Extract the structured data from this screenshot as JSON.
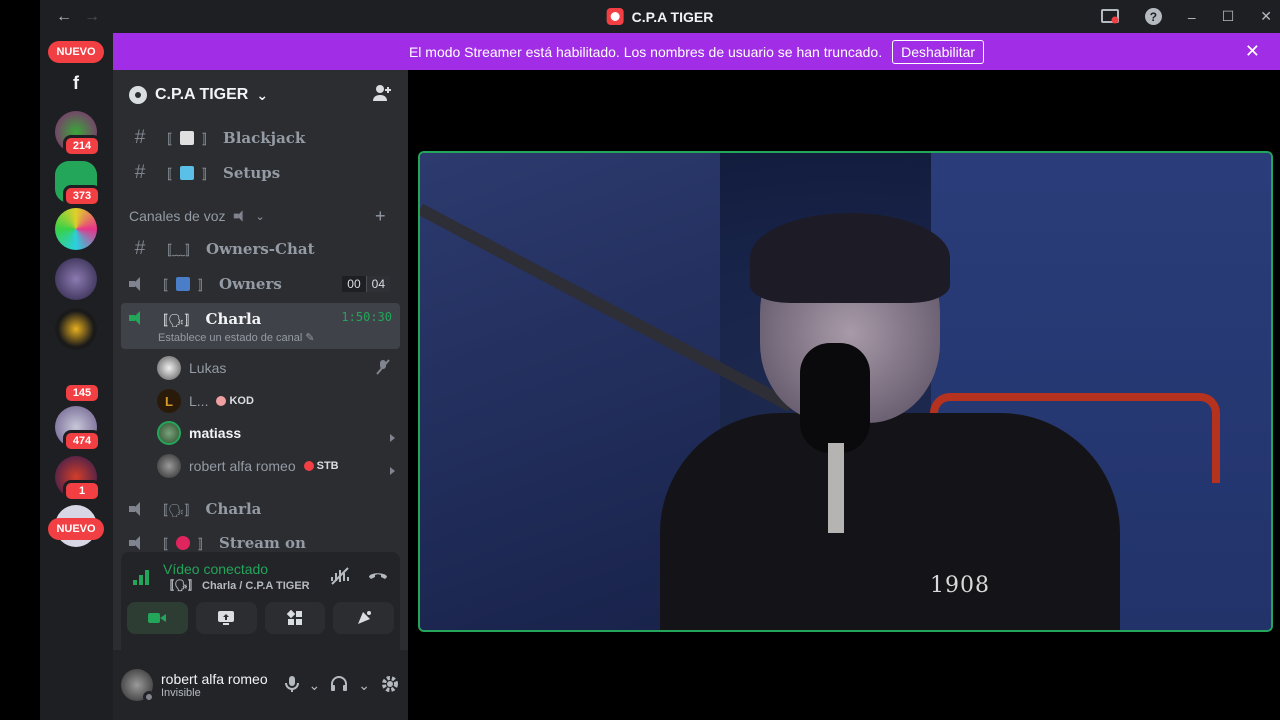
{
  "titlebar": {
    "back": "←",
    "forward": "→",
    "title": "C.P.A TIGER",
    "minimize": "–",
    "maximize": "☐",
    "close": "✕",
    "help": "?"
  },
  "rail": {
    "badges": [
      "214",
      "373",
      "145",
      "474",
      "1"
    ],
    "nuevo_top": "NUEVO",
    "nuevo_bottom": "NUEVO",
    "f_label": "f"
  },
  "banner": {
    "text": "El modo Streamer está habilitado. Los nombres de usuario se han truncado.",
    "button": "Deshabilitar",
    "close": "✕"
  },
  "guild": {
    "name": "C.P.A TIGER",
    "chevron": "⌄"
  },
  "channels": {
    "text": [
      {
        "name": "Blackjack",
        "open": "〚",
        "close": "〛"
      },
      {
        "name": "Setups",
        "open": "〚",
        "close": "〛"
      }
    ],
    "category": "Canales de voz",
    "category_plus": "+",
    "voice": [
      {
        "name": "Owners-Chat"
      },
      {
        "name": "Owners",
        "limit": [
          "00",
          "04"
        ]
      },
      {
        "name": "Charla",
        "timer": "1:50:30",
        "status": "Establece un estado de canal"
      },
      {
        "name": "Charla"
      },
      {
        "name": "Stream on"
      }
    ],
    "members": [
      {
        "name": "Lukas"
      },
      {
        "name": "L...",
        "tag": "KOD"
      },
      {
        "name": "matiass"
      },
      {
        "name": "robert alfa romeo",
        "tag": "STB"
      }
    ]
  },
  "voice_panel": {
    "status": "Vídeo conectado",
    "location": "〚🗣〛 Charla / C.P.A TIGER"
  },
  "user": {
    "name": "robert alfa romeo",
    "status": "Invisible"
  },
  "video": {
    "jersey_text": "1908"
  },
  "colors": {
    "accent_green": "#23a55a",
    "banner_purple": "#a12ee6",
    "badge_red": "#f23f43"
  }
}
